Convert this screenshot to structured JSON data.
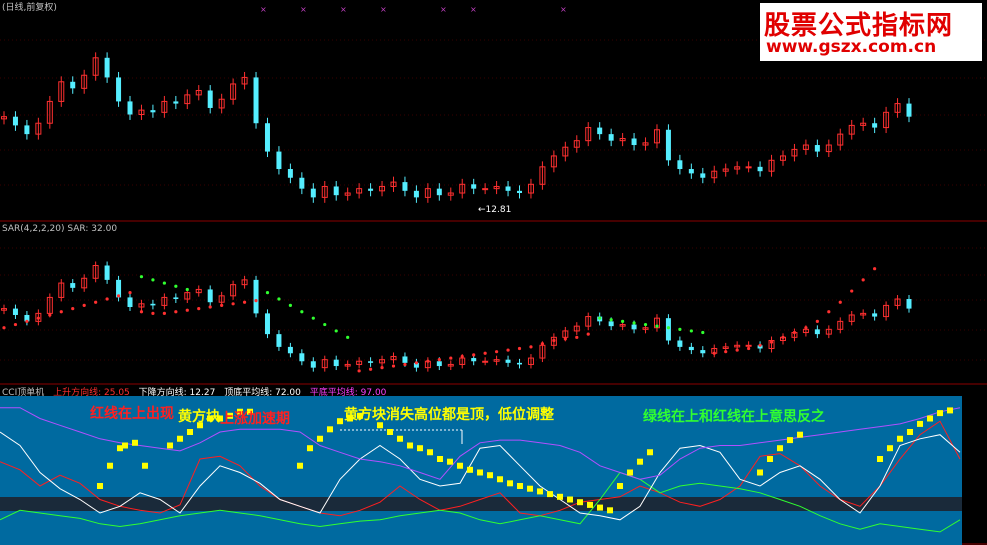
{
  "panels": {
    "price": {
      "title": "(日线,前复权)"
    },
    "sar": {
      "title": "SAR(4,2,2,20) SAR: 32.00",
      "low_label": "←12.81"
    },
    "indicator": {
      "title": "CCI顶单机",
      "fields": [
        {
          "text": "上升方向线: 25.05",
          "color": "#ff3030"
        },
        {
          "text": "下降方向线: 12.27",
          "color": "#ffffff"
        },
        {
          "text": "顶底平均线: 72.00",
          "color": "#ffffff"
        },
        {
          "text": "平底平均线: 97.00",
          "color": "#ff40ff"
        }
      ]
    }
  },
  "annotations": [
    {
      "text": "红线在上出现",
      "color": "#ff2020"
    },
    {
      "text": "黄方块",
      "color": "#ffff00"
    },
    {
      "text": "上涨加速期",
      "color": "#ff2020"
    },
    {
      "text": "黄方块消失高位都是顶，低位调整",
      "color": "#ffff00"
    },
    {
      "text": "绿线在上和红线在上意思反之",
      "color": "#30ff30"
    }
  ],
  "watermark": {
    "line1": "股票公式指标网",
    "line2": "www.gszx.com.cn"
  },
  "colors": {
    "up": "#ff3030",
    "down": "#55eeff",
    "sar_up": "#ff3030",
    "sar_down": "#30ff30",
    "indicator_bg": "#006aa0",
    "yellow": "#ffff00"
  },
  "chart_data": [
    {
      "type": "candlestick",
      "x": [
        1,
        3,
        5,
        7,
        9,
        11,
        13,
        15,
        17,
        19,
        21,
        23,
        25,
        27,
        29,
        31,
        33,
        35,
        37,
        39,
        41,
        43,
        45,
        47,
        49,
        51,
        53,
        55,
        57,
        59,
        61,
        63,
        65,
        67,
        69,
        71,
        73,
        75,
        77,
        79,
        81,
        83,
        85,
        87,
        89,
        91,
        93,
        95,
        97,
        99,
        101,
        103,
        105,
        107,
        109,
        111,
        113,
        115,
        117,
        119,
        121,
        123,
        125,
        127,
        129,
        131,
        133,
        135,
        137,
        139,
        141,
        143,
        145,
        147,
        149,
        151,
        153,
        155,
        157,
        159
      ],
      "close": [
        16.8,
        16.4,
        16.0,
        16.5,
        17.5,
        18.4,
        18.1,
        18.7,
        19.5,
        18.6,
        17.5,
        16.9,
        17.1,
        17.0,
        17.5,
        17.4,
        17.8,
        18.0,
        17.2,
        17.6,
        18.3,
        18.6,
        16.5,
        15.2,
        14.4,
        14.0,
        13.5,
        13.1,
        13.6,
        13.2,
        13.3,
        13.5,
        13.4,
        13.6,
        13.8,
        13.4,
        13.1,
        13.5,
        13.2,
        13.3,
        13.7,
        13.5,
        13.5,
        13.6,
        13.4,
        13.3,
        13.7,
        14.5,
        15.0,
        15.4,
        15.7,
        16.3,
        16.0,
        15.7,
        15.8,
        15.5,
        15.6,
        16.2,
        14.8,
        14.4,
        14.2,
        14.0,
        14.3,
        14.4,
        14.5,
        14.5,
        14.3,
        14.8,
        15.0,
        15.3,
        15.5,
        15.2,
        15.5,
        16.0,
        16.4,
        16.5,
        16.3,
        17.0,
        17.4,
        16.8
      ],
      "min": 12.81,
      "ylim": [
        12.2,
        21.6
      ]
    },
    {
      "type": "sar",
      "sar_up": [
        15.6,
        15.8,
        16.0,
        16.2,
        16.4,
        16.6,
        16.8,
        17.0,
        17.2,
        17.4,
        17.6,
        17.8,
        16.6,
        16.5,
        16.5,
        16.6,
        16.7,
        16.8,
        16.9,
        17.0,
        17.1,
        17.2,
        17.3,
        null,
        null,
        null,
        null,
        null,
        null,
        null,
        null,
        12.9,
        13.0,
        13.1,
        13.2,
        13.3,
        13.4,
        13.5,
        13.6,
        13.7,
        13.8,
        13.9,
        14.0,
        14.1,
        14.2,
        14.3,
        14.4,
        14.6,
        14.8,
        14.9,
        15.0,
        15.2,
        null,
        null,
        null,
        null,
        null,
        null,
        null,
        null,
        null,
        null,
        14.0,
        14.1,
        14.2,
        14.3,
        14.5,
        14.7,
        15.0,
        15.3,
        15.6,
        16.0,
        16.6,
        17.2,
        17.9,
        18.6,
        19.3,
        null,
        null,
        null
      ],
      "sar_down": [
        null,
        null,
        null,
        null,
        null,
        null,
        null,
        null,
        null,
        null,
        null,
        null,
        18.8,
        18.6,
        18.4,
        18.2,
        18.0,
        null,
        null,
        null,
        null,
        null,
        null,
        17.8,
        17.4,
        17.0,
        16.6,
        16.2,
        15.8,
        15.4,
        15.0,
        null,
        null,
        null,
        null,
        null,
        null,
        null,
        null,
        null,
        null,
        null,
        null,
        null,
        null,
        null,
        null,
        null,
        null,
        null,
        null,
        null,
        16.2,
        16.1,
        16.0,
        15.9,
        15.8,
        15.7,
        15.6,
        15.5,
        15.4,
        15.3,
        null,
        null,
        null,
        null,
        null,
        null,
        null,
        null,
        null,
        null,
        null,
        null,
        null,
        null,
        null,
        null,
        null,
        null
      ],
      "ylim": [
        12.2,
        21.6
      ]
    },
    {
      "type": "line",
      "x": [
        0,
        20,
        40,
        60,
        80,
        100,
        120,
        140,
        160,
        180,
        200,
        220,
        240,
        260,
        280,
        300,
        320,
        340,
        360,
        380,
        400,
        420,
        440,
        460,
        480,
        500,
        520,
        540,
        560,
        580,
        600,
        620,
        640,
        660,
        680,
        700,
        720,
        740,
        760,
        780,
        800,
        820,
        840,
        860,
        880,
        900,
        920,
        940,
        960
      ],
      "ylim": [
        0,
        100
      ],
      "series": [
        {
          "color": "#ff2020",
          "values": [
            58,
            52,
            40,
            48,
            42,
            30,
            25,
            22,
            20,
            26,
            60,
            62,
            55,
            40,
            30,
            25,
            20,
            18,
            22,
            28,
            40,
            30,
            22,
            25,
            30,
            35,
            20,
            18,
            22,
            28,
            30,
            32,
            40,
            35,
            28,
            25,
            30,
            40,
            62,
            64,
            55,
            40,
            30,
            25,
            40,
            60,
            78,
            88,
            60
          ]
        },
        {
          "color": "#30ff30",
          "values": [
            15,
            22,
            20,
            18,
            16,
            12,
            10,
            12,
            15,
            18,
            20,
            22,
            20,
            18,
            15,
            12,
            10,
            12,
            14,
            15,
            18,
            20,
            22,
            20,
            15,
            12,
            15,
            18,
            15,
            12,
            30,
            50,
            45,
            35,
            40,
            42,
            40,
            38,
            35,
            30,
            25,
            18,
            12,
            8,
            12,
            10,
            8,
            6,
            15
          ]
        },
        {
          "color": "#ffffff",
          "values": [
            80,
            70,
            50,
            38,
            30,
            20,
            25,
            35,
            30,
            20,
            40,
            55,
            50,
            42,
            30,
            25,
            20,
            45,
            60,
            70,
            60,
            45,
            40,
            42,
            68,
            70,
            55,
            40,
            30,
            20,
            18,
            15,
            25,
            50,
            68,
            70,
            65,
            45,
            40,
            50,
            55,
            45,
            30,
            20,
            40,
            70,
            75,
            78,
            65
          ]
        },
        {
          "color": "#b050ff",
          "values": [
            98,
            98,
            90,
            85,
            80,
            75,
            72,
            70,
            68,
            66,
            72,
            80,
            82,
            82,
            82,
            80,
            70,
            65,
            60,
            58,
            55,
            50,
            45,
            62,
            72,
            74,
            74,
            72,
            70,
            65,
            55,
            50,
            45,
            48,
            60,
            68,
            70,
            70,
            72,
            74,
            76,
            78,
            80,
            82,
            84,
            86,
            90,
            95,
            98
          ]
        }
      ],
      "yellow_blocks": [
        [
          100,
          40
        ],
        [
          110,
          55
        ],
        [
          120,
          68
        ],
        [
          125,
          70
        ],
        [
          135,
          72
        ],
        [
          145,
          55
        ],
        [
          170,
          70
        ],
        [
          180,
          75
        ],
        [
          190,
          80
        ],
        [
          200,
          85
        ],
        [
          210,
          90
        ],
        [
          220,
          90
        ],
        [
          230,
          92
        ],
        [
          240,
          95
        ],
        [
          250,
          95
        ],
        [
          300,
          55
        ],
        [
          310,
          68
        ],
        [
          320,
          75
        ],
        [
          330,
          82
        ],
        [
          340,
          88
        ],
        [
          350,
          90
        ],
        [
          360,
          92
        ],
        [
          380,
          85
        ],
        [
          390,
          80
        ],
        [
          400,
          75
        ],
        [
          410,
          70
        ],
        [
          420,
          68
        ],
        [
          430,
          65
        ],
        [
          440,
          60
        ],
        [
          450,
          58
        ],
        [
          460,
          55
        ],
        [
          470,
          52
        ],
        [
          480,
          50
        ],
        [
          490,
          48
        ],
        [
          500,
          45
        ],
        [
          510,
          42
        ],
        [
          520,
          40
        ],
        [
          530,
          38
        ],
        [
          540,
          36
        ],
        [
          550,
          34
        ],
        [
          560,
          32
        ],
        [
          570,
          30
        ],
        [
          580,
          28
        ],
        [
          590,
          26
        ],
        [
          600,
          24
        ],
        [
          610,
          22
        ],
        [
          620,
          40
        ],
        [
          630,
          50
        ],
        [
          640,
          58
        ],
        [
          650,
          65
        ],
        [
          760,
          50
        ],
        [
          770,
          60
        ],
        [
          780,
          68
        ],
        [
          790,
          74
        ],
        [
          800,
          78
        ],
        [
          880,
          60
        ],
        [
          890,
          68
        ],
        [
          900,
          75
        ],
        [
          910,
          80
        ],
        [
          920,
          86
        ],
        [
          930,
          90
        ],
        [
          940,
          94
        ],
        [
          950,
          96
        ]
      ]
    }
  ]
}
